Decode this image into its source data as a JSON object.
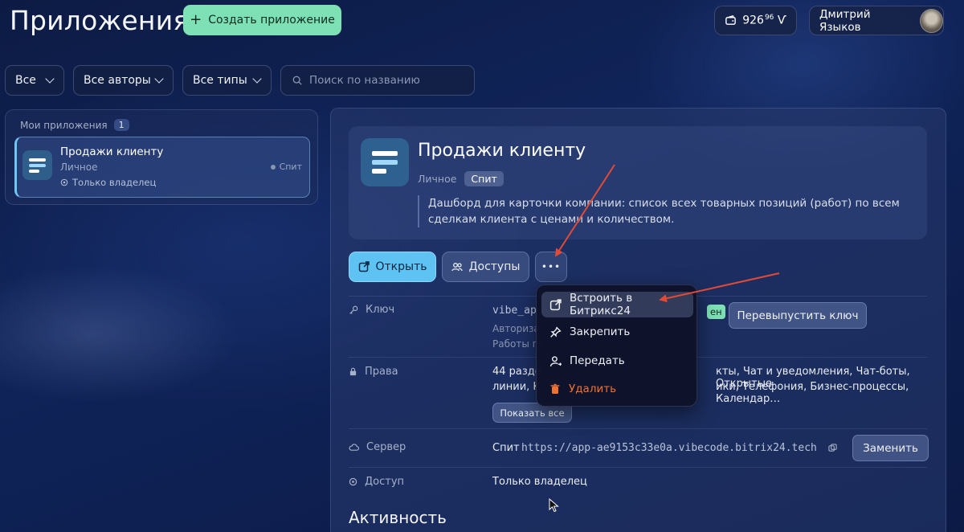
{
  "header": {
    "title": "Приложения",
    "create_label": "Создать приложение",
    "balance_int": "926",
    "balance_frac": "96",
    "balance_currency": "Ѵ",
    "user_name": "Дмитрий Языков"
  },
  "filters": {
    "all": "Все",
    "authors": "Все авторы",
    "types": "Все типы",
    "search_placeholder": "Поиск по названию"
  },
  "sidebar": {
    "heading": "Мои приложения",
    "count": "1",
    "app": {
      "name": "Продажи клиенту",
      "type": "Личное",
      "status": "Спит",
      "access": "Только владелец"
    }
  },
  "detail": {
    "title": "Продажи клиенту",
    "type": "Личное",
    "status": "Спит",
    "description": "Дашборд для карточки компании: список всех товарных позиций (работ) по всем сделкам клиента с ценами и количеством.",
    "open_label": "Открыть",
    "access_label": "Доступы",
    "more_label": "•••",
    "key": {
      "label": "Ключ",
      "value": "vibe_ap",
      "line2": "Авториза",
      "line3": "Работы по",
      "badge": "ен",
      "reissue_label": "Перевыпустить ключ"
    },
    "rights": {
      "label": "Права",
      "line1_left": "44 разде",
      "line1_right": "кты, Чат и уведомления, Чат-боты, Открытые",
      "line2_left": "линии, К",
      "line2_right": "ики, Телефония, Бизнес-процессы, Календар…",
      "show_all_label": "Показать все"
    },
    "server": {
      "label": "Сервер",
      "status": "Спит",
      "url": "https://app-ae9153c33e0a.vibecode.bitrix24.tech",
      "replace_label": "Заменить"
    },
    "access": {
      "label": "Доступ",
      "value": "Только владелец"
    },
    "activity_heading": "Активность"
  },
  "menu": {
    "items": [
      {
        "label": "Встроить в Битрикс24",
        "icon": "external-link-icon"
      },
      {
        "label": "Закрепить",
        "icon": "pin-icon"
      },
      {
        "label": "Передать",
        "icon": "user-transfer-icon"
      },
      {
        "label": "Удалить",
        "icon": "trash-icon"
      }
    ]
  },
  "colors": {
    "accent_green": "#7ee0b5",
    "accent_blue": "#5ec2f2",
    "danger": "#f07232",
    "annotation_arrow": "#e04a36"
  }
}
